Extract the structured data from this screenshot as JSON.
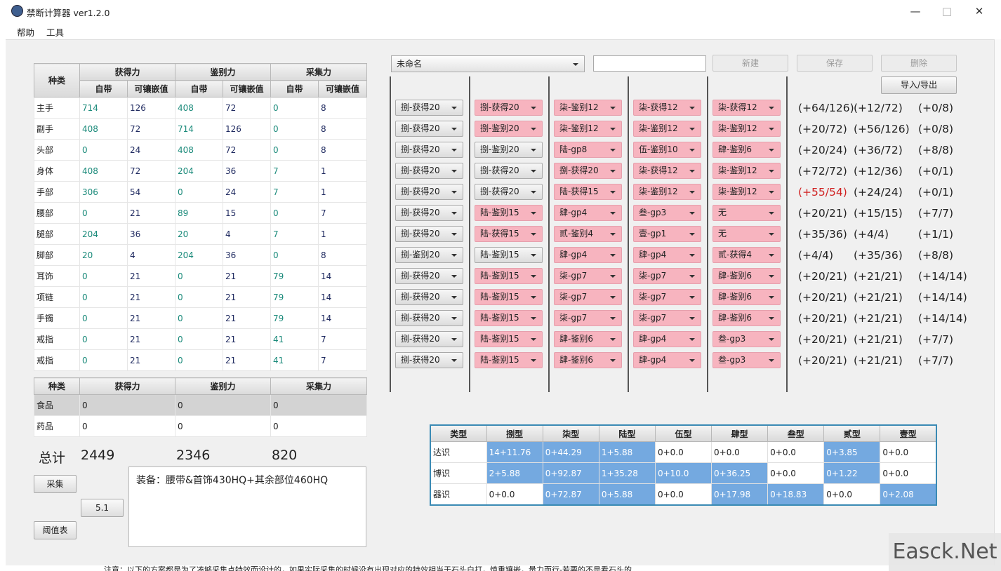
{
  "window": {
    "title": "禁断计算器 ver1.2.0"
  },
  "menu": [
    "帮助",
    "工具"
  ],
  "gear_table": {
    "headers": {
      "kind": "种类",
      "groups": [
        "获得力",
        "鉴别力",
        "采集力"
      ],
      "sub": [
        "自带",
        "可镶嵌值"
      ]
    },
    "rows": [
      [
        "主手",
        "714",
        "126",
        "408",
        "72",
        "0",
        "8"
      ],
      [
        "副手",
        "408",
        "72",
        "714",
        "126",
        "0",
        "8"
      ],
      [
        "头部",
        "0",
        "24",
        "408",
        "72",
        "0",
        "8"
      ],
      [
        "身体",
        "408",
        "72",
        "204",
        "36",
        "7",
        "1"
      ],
      [
        "手部",
        "306",
        "54",
        "0",
        "24",
        "7",
        "1"
      ],
      [
        "腰部",
        "0",
        "21",
        "89",
        "15",
        "0",
        "7"
      ],
      [
        "腿部",
        "204",
        "36",
        "20",
        "4",
        "7",
        "1"
      ],
      [
        "脚部",
        "20",
        "4",
        "204",
        "36",
        "0",
        "8"
      ],
      [
        "耳饰",
        "0",
        "21",
        "0",
        "21",
        "79",
        "14"
      ],
      [
        "项链",
        "0",
        "21",
        "0",
        "21",
        "79",
        "14"
      ],
      [
        "手镯",
        "0",
        "21",
        "0",
        "21",
        "79",
        "14"
      ],
      [
        "戒指",
        "0",
        "21",
        "0",
        "21",
        "41",
        "7"
      ],
      [
        "戒指",
        "0",
        "21",
        "0",
        "21",
        "41",
        "7"
      ]
    ]
  },
  "food_table": {
    "headers": [
      "种类",
      "获得力",
      "鉴别力",
      "采集力"
    ],
    "rows": [
      [
        "食品",
        "0",
        "0",
        "0"
      ],
      [
        "药品",
        "0",
        "0",
        "0"
      ]
    ]
  },
  "totals": {
    "label": "总计",
    "values": [
      "2449",
      "2346",
      "820"
    ]
  },
  "buttons": {
    "gather": "采集",
    "version": "5.1",
    "threshold": "阈值表",
    "new": "新建",
    "save": "保存",
    "delete": "删除",
    "import_export": "导入/导出"
  },
  "note": "装备：腰带&首饰430HQ+其余部位460HQ",
  "preset": {
    "selected": "未命名",
    "name_input": ""
  },
  "materia": [
    {
      "cells": [
        "捌-获得20",
        "捌-获得20",
        "柒-鉴别12",
        "柒-获得12",
        "柒-获得12"
      ],
      "pink": [
        false,
        true,
        true,
        true,
        true
      ],
      "results": [
        "(+64/126)",
        "(+12/72)",
        "(+0/8)"
      ],
      "red": [
        false,
        false,
        false
      ]
    },
    {
      "cells": [
        "捌-获得20",
        "捌-鉴别20",
        "柒-鉴别12",
        "柒-鉴别12",
        "柒-鉴别12"
      ],
      "pink": [
        false,
        true,
        true,
        true,
        true
      ],
      "results": [
        "(+20/72)",
        "(+56/126)",
        "(+0/8)"
      ],
      "red": [
        false,
        false,
        false
      ]
    },
    {
      "cells": [
        "捌-获得20",
        "捌-鉴别20",
        "陆-gp8",
        "伍-鉴别10",
        "肆-鉴别6"
      ],
      "pink": [
        false,
        false,
        true,
        true,
        true
      ],
      "results": [
        "(+20/24)",
        "(+36/72)",
        "(+8/8)"
      ],
      "red": [
        false,
        false,
        false
      ]
    },
    {
      "cells": [
        "捌-获得20",
        "捌-获得20",
        "捌-获得20",
        "柒-获得12",
        "柒-鉴别12"
      ],
      "pink": [
        false,
        false,
        true,
        true,
        true
      ],
      "results": [
        "(+72/72)",
        "(+12/36)",
        "(+0/1)"
      ],
      "red": [
        false,
        false,
        false
      ]
    },
    {
      "cells": [
        "捌-获得20",
        "捌-获得20",
        "陆-获得15",
        "柒-鉴别12",
        "柒-鉴别12"
      ],
      "pink": [
        false,
        false,
        true,
        true,
        true
      ],
      "results": [
        "(+55/54)",
        "(+24/24)",
        "(+0/1)"
      ],
      "red": [
        true,
        false,
        false
      ]
    },
    {
      "cells": [
        "捌-获得20",
        "陆-鉴别15",
        "肆-gp4",
        "叁-gp3",
        "无"
      ],
      "pink": [
        false,
        true,
        true,
        true,
        true
      ],
      "results": [
        "(+20/21)",
        "(+15/15)",
        "(+7/7)"
      ],
      "red": [
        false,
        false,
        false
      ]
    },
    {
      "cells": [
        "捌-获得20",
        "陆-获得15",
        "贰-鉴别4",
        "壹-gp1",
        "无"
      ],
      "pink": [
        false,
        true,
        true,
        true,
        true
      ],
      "results": [
        "(+35/36)",
        "(+4/4)",
        "(+1/1)"
      ],
      "red": [
        false,
        false,
        false
      ]
    },
    {
      "cells": [
        "捌-鉴别20",
        "陆-鉴别15",
        "肆-gp4",
        "肆-gp4",
        "贰-获得4"
      ],
      "pink": [
        false,
        false,
        true,
        true,
        true
      ],
      "results": [
        "(+4/4)",
        "(+35/36)",
        "(+8/8)"
      ],
      "red": [
        false,
        false,
        false
      ]
    },
    {
      "cells": [
        "捌-获得20",
        "陆-鉴别15",
        "柒-gp7",
        "柒-gp7",
        "肆-鉴别6"
      ],
      "pink": [
        false,
        true,
        true,
        true,
        true
      ],
      "results": [
        "(+20/21)",
        "(+21/21)",
        "(+14/14)"
      ],
      "red": [
        false,
        false,
        false
      ]
    },
    {
      "cells": [
        "捌-获得20",
        "陆-鉴别15",
        "柒-gp7",
        "柒-gp7",
        "肆-鉴别6"
      ],
      "pink": [
        false,
        true,
        true,
        true,
        true
      ],
      "results": [
        "(+20/21)",
        "(+21/21)",
        "(+14/14)"
      ],
      "red": [
        false,
        false,
        false
      ]
    },
    {
      "cells": [
        "捌-获得20",
        "陆-鉴别15",
        "柒-gp7",
        "柒-gp7",
        "肆-鉴别6"
      ],
      "pink": [
        false,
        true,
        true,
        true,
        true
      ],
      "results": [
        "(+20/21)",
        "(+21/21)",
        "(+14/14)"
      ],
      "red": [
        false,
        false,
        false
      ]
    },
    {
      "cells": [
        "捌-获得20",
        "陆-鉴别15",
        "肆-鉴别6",
        "肆-gp4",
        "叁-gp3"
      ],
      "pink": [
        false,
        true,
        true,
        true,
        true
      ],
      "results": [
        "(+20/21)",
        "(+21/21)",
        "(+7/7)"
      ],
      "red": [
        false,
        false,
        false
      ]
    },
    {
      "cells": [
        "捌-获得20",
        "陆-鉴别15",
        "肆-鉴别6",
        "肆-gp4",
        "叁-gp3"
      ],
      "pink": [
        false,
        true,
        true,
        true,
        true
      ],
      "results": [
        "(+20/21)",
        "(+21/21)",
        "(+7/7)"
      ],
      "red": [
        false,
        false,
        false
      ]
    }
  ],
  "summary": {
    "headers": [
      "类型",
      "捌型",
      "柒型",
      "陆型",
      "伍型",
      "肆型",
      "叁型",
      "贰型",
      "壹型"
    ],
    "rows": [
      {
        "cells": [
          "达识",
          "14+11.76",
          "0+44.29",
          "1+5.88",
          "0+0.0",
          "0+0.0",
          "0+0.0",
          "0+3.85",
          "0+0.0"
        ],
        "hl": [
          false,
          true,
          true,
          true,
          false,
          false,
          false,
          true,
          false
        ]
      },
      {
        "cells": [
          "博识",
          "2+5.88",
          "0+92.87",
          "1+35.28",
          "0+10.0",
          "0+36.25",
          "0+0.0",
          "0+1.22",
          "0+0.0"
        ],
        "hl": [
          false,
          true,
          true,
          true,
          true,
          true,
          false,
          true,
          false
        ]
      },
      {
        "cells": [
          "器识",
          "0+0.0",
          "0+72.87",
          "0+5.88",
          "0+0.0",
          "0+17.98",
          "0+18.83",
          "0+0.0",
          "0+2.08"
        ],
        "hl": [
          false,
          false,
          true,
          true,
          false,
          true,
          true,
          false,
          true
        ]
      }
    ]
  },
  "footer_text": "注意：以下的方案都是为了凑够采集点特效而设计的，如果实际采集的时候没有出现对应的特效相当于石头白打，慎重镶嵌，量力而行-若要的不是看石头的",
  "watermark": "Easck.Net"
}
